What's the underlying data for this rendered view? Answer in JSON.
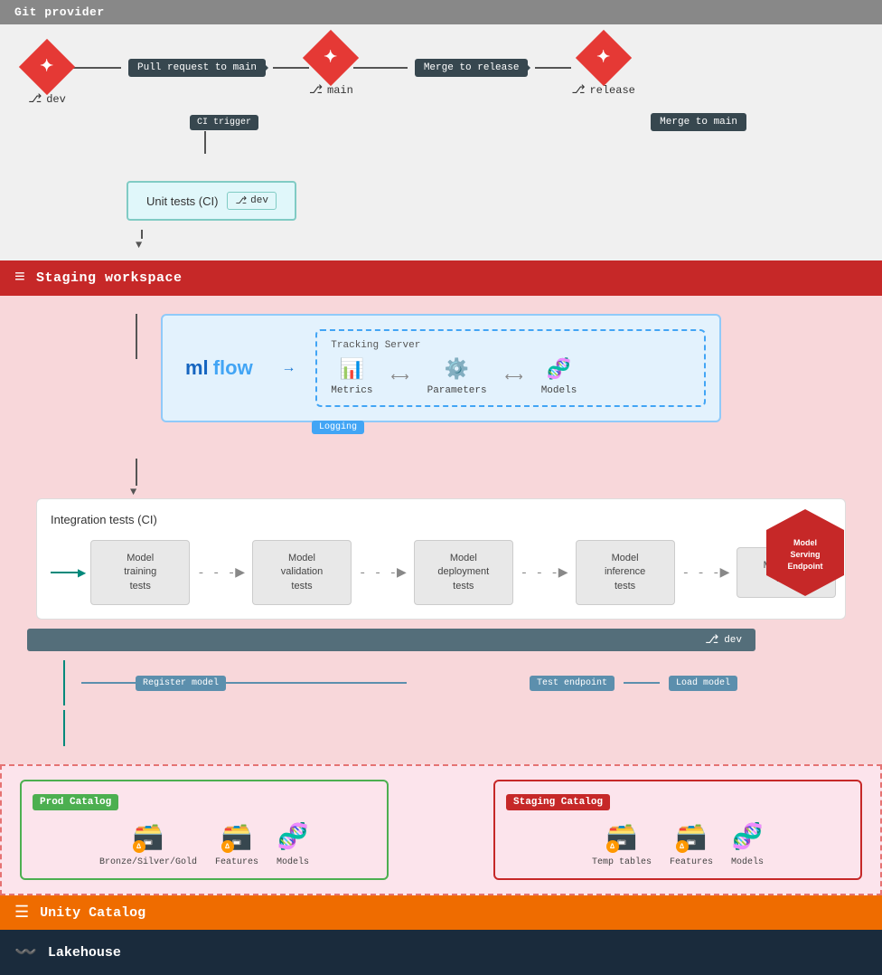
{
  "gitProvider": {
    "label": "Git provider"
  },
  "branches": {
    "dev": "dev",
    "main": "main",
    "release": "release"
  },
  "arrows": {
    "pullRequestToMain": "Pull request to main",
    "mergeToRelease": "Merge to release",
    "mergeToMain": "Merge to main",
    "ciTrigger": "CI trigger"
  },
  "unitTests": {
    "label": "Unit tests (CI)",
    "branch": "dev"
  },
  "stagingWorkspace": {
    "label": "Staging workspace"
  },
  "mlflow": {
    "logo": "mlflow",
    "trackingServer": "Tracking Server",
    "logging": "Logging",
    "metrics": "Metrics",
    "parameters": "Parameters",
    "models": "Models"
  },
  "integrationTests": {
    "title": "Integration tests (CI)",
    "steps": [
      {
        "label": "Model\ntraining\ntests"
      },
      {
        "label": "Model\nvalidation\ntests"
      },
      {
        "label": "Model\ndeployment\ntests"
      },
      {
        "label": "Model\ninference\ntests"
      },
      {
        "label": "Monitoring\ntests"
      }
    ]
  },
  "modelServingEndpoint": {
    "label": "Model Serving Endpoint"
  },
  "devBranch": "dev",
  "labels": {
    "registerModel": "Register model",
    "testEndpoint": "Test endpoint",
    "loadModel": "Load model"
  },
  "unityCatalog": {
    "label": "Unity Catalog"
  },
  "prodCatalog": {
    "title": "Prod Catalog",
    "items": [
      {
        "label": "Bronze/Silver/Gold",
        "icon": "🗃️"
      },
      {
        "label": "Features",
        "icon": "🗃️"
      },
      {
        "label": "Models",
        "icon": "🧬"
      }
    ]
  },
  "stagingCatalog": {
    "title": "Staging Catalog",
    "items": [
      {
        "label": "Temp tables",
        "icon": "🗃️"
      },
      {
        "label": "Features",
        "icon": "🗃️"
      },
      {
        "label": "Models",
        "icon": "🧬"
      }
    ]
  },
  "lakehouse": {
    "label": "Lakehouse"
  }
}
